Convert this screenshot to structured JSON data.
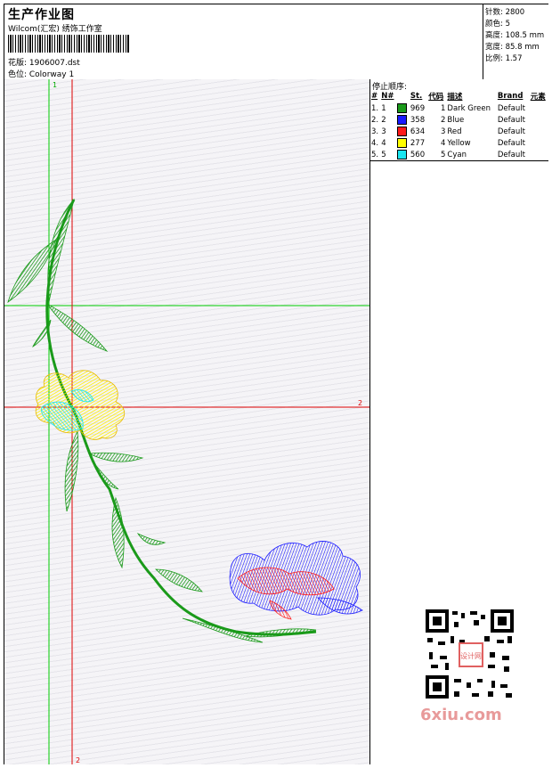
{
  "header": {
    "title": "生产作业图",
    "company": "Wilcom(汇宏) 绣饰工作室",
    "design_line": "花版:  1906007.dst",
    "colorway_line": "色位:  Colorway 1"
  },
  "stats": [
    "针数: 2800",
    "颜色: 5",
    "高度: 108.5 mm",
    "宽度: 85.8 mm",
    "比例: 1.57"
  ],
  "stop_sequence": {
    "title": "停止顺序:",
    "headers": [
      "#",
      "N#",
      "St.",
      "代码",
      "描述",
      "Brand",
      "元素"
    ],
    "rows": [
      {
        "num": "1.",
        "n": "1",
        "color": "#1a9a1a",
        "st": "969",
        "code": "1",
        "desc": "Dark Green",
        "brand": "Default"
      },
      {
        "num": "2.",
        "n": "2",
        "color": "#1a1aff",
        "st": "358",
        "code": "2",
        "desc": "Blue",
        "brand": "Default"
      },
      {
        "num": "3.",
        "n": "3",
        "color": "#ff1a1a",
        "st": "634",
        "code": "3",
        "desc": "Red",
        "brand": "Default"
      },
      {
        "num": "4.",
        "n": "4",
        "color": "#ffff00",
        "st": "277",
        "code": "4",
        "desc": "Yellow",
        "brand": "Default"
      },
      {
        "num": "5.",
        "n": "5",
        "color": "#19e6f0",
        "st": "560",
        "code": "5",
        "desc": "Cyan",
        "brand": "Default"
      }
    ]
  },
  "guides": {
    "v1_label": "1",
    "h2_label": "2",
    "v2_label": "2"
  },
  "colors": {
    "green": "#1a9a1a",
    "blue": "#1a1aff",
    "red": "#ff1a1a",
    "yellow": "#ffff00",
    "cyan": "#19e6f0"
  },
  "watermark": {
    "text": "6xiu.com",
    "seal_text": "设计网"
  }
}
